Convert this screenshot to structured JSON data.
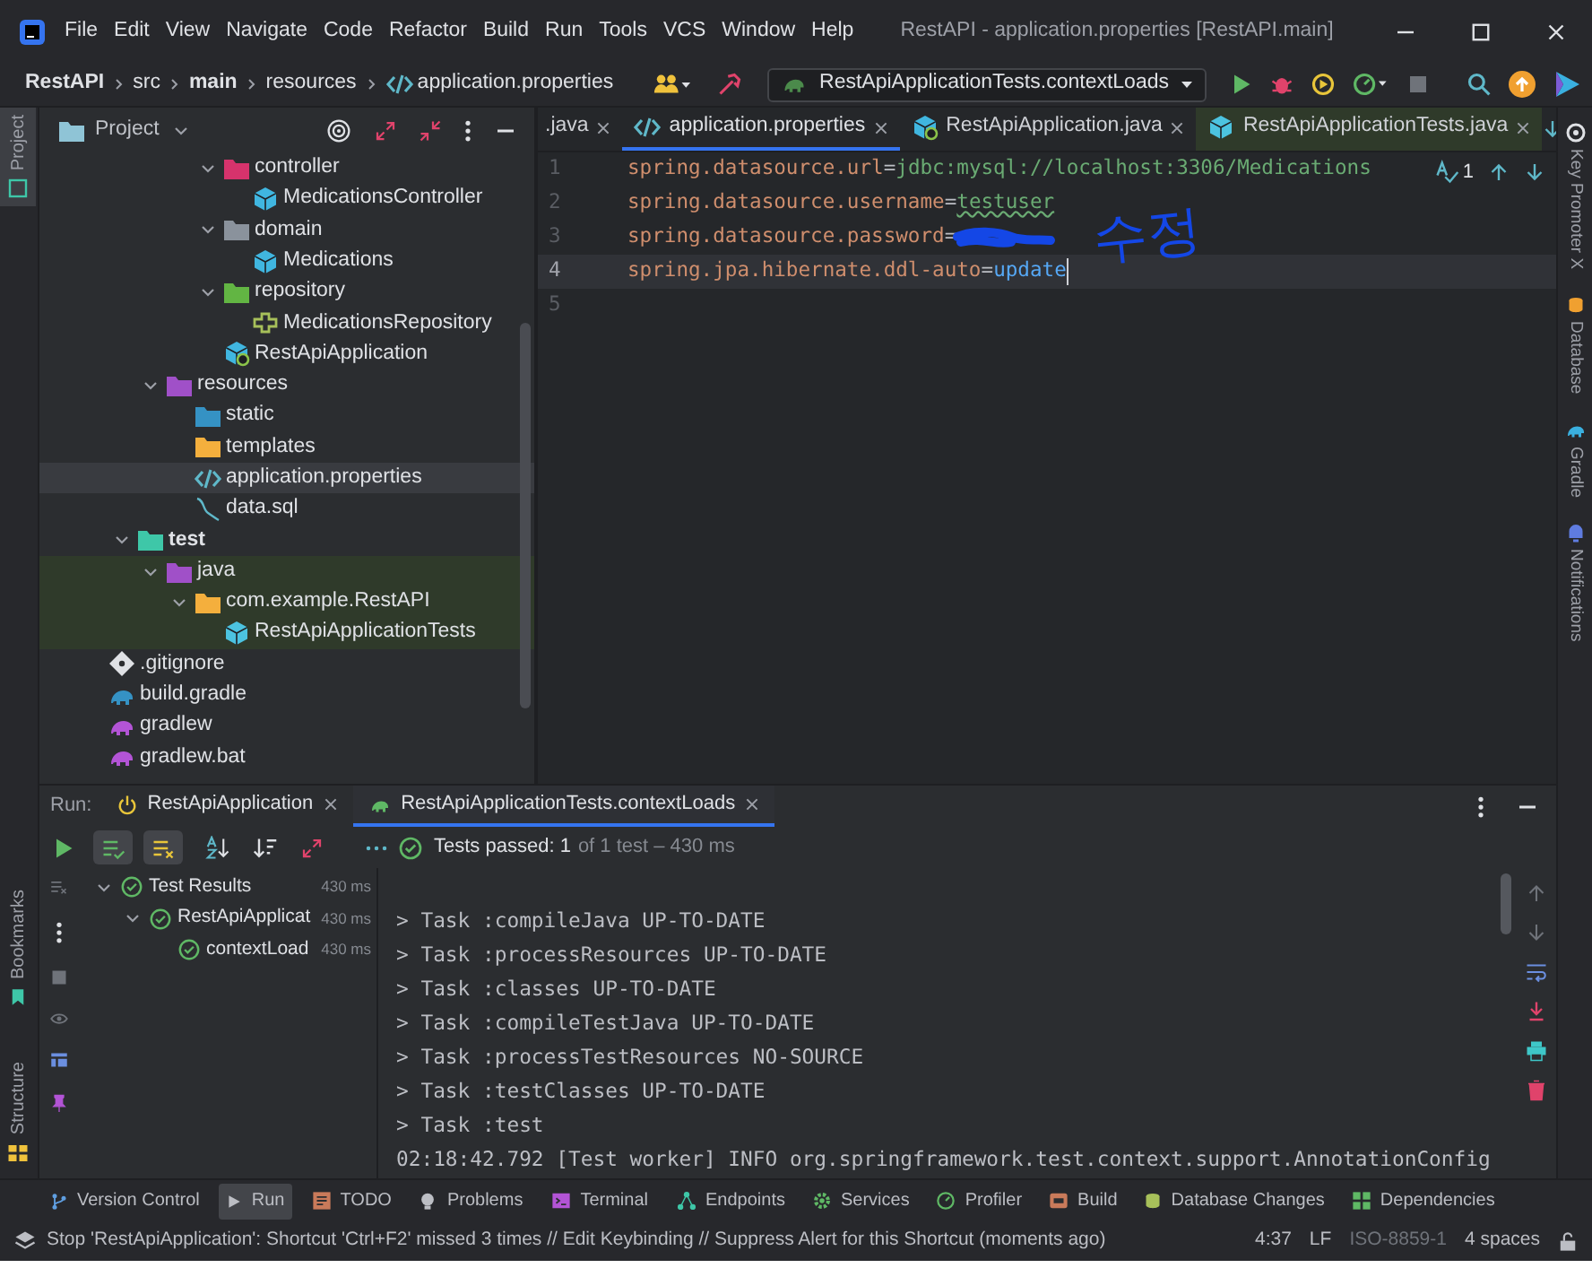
{
  "window": {
    "title": "RestAPI - application.properties [RestAPI.main]"
  },
  "menu": [
    "File",
    "Edit",
    "View",
    "Navigate",
    "Code",
    "Refactor",
    "Build",
    "Run",
    "Tools",
    "VCS",
    "Window",
    "Help"
  ],
  "breadcrumbs": [
    {
      "label": "RestAPI",
      "bold": true
    },
    {
      "label": "src",
      "bold": false
    },
    {
      "label": "main",
      "bold": true
    },
    {
      "label": "resources",
      "bold": false
    },
    {
      "label": "application.properties",
      "bold": false,
      "kind": "properties"
    }
  ],
  "run_configuration": {
    "label": "RestApiApplicationTests.contextLoads"
  },
  "left_tool_tabs": [
    {
      "label": "Project",
      "selected": true
    },
    {
      "label": "Bookmarks",
      "selected": false
    },
    {
      "label": "Structure",
      "selected": false
    }
  ],
  "right_tool_tabs": [
    {
      "label": "Key Promoter X"
    },
    {
      "label": "Database"
    },
    {
      "label": "Gradle"
    },
    {
      "label": "Notifications"
    }
  ],
  "project": {
    "title": "Project",
    "tree": [
      {
        "children": [
          {
            "children": [
              {
                "children": [
                  {
                    "children": [
                      {
                        "label": "controller",
                        "kind": "folder",
                        "color": "#d6336c",
                        "expanded": true,
                        "selected": false,
                        "test_scope": false,
                        "children": [
                          {
                            "label": "MedicationsController",
                            "kind": "class",
                            "selected": false,
                            "test_scope": false
                          }
                        ]
                      },
                      {
                        "label": "domain",
                        "kind": "folder",
                        "color": "#8a929c",
                        "expanded": true,
                        "selected": false,
                        "test_scope": false,
                        "children": [
                          {
                            "label": "Medications",
                            "kind": "class",
                            "selected": false,
                            "test_scope": false
                          }
                        ]
                      },
                      {
                        "label": "repository",
                        "kind": "folder",
                        "color": "#62b543",
                        "expanded": true,
                        "selected": false,
                        "test_scope": false,
                        "children": [
                          {
                            "label": "MedicationsRepository",
                            "kind": "interface",
                            "selected": false,
                            "test_scope": false
                          }
                        ]
                      },
                      {
                        "label": "RestApiApplication",
                        "kind": "app-class",
                        "selected": false,
                        "test_scope": false
                      }
                    ]
                  }
                ]
              },
              {
                "label": "resources",
                "kind": "folder",
                "color": "#a050c8",
                "expanded": true,
                "selected": false,
                "test_scope": false,
                "children": [
                  {
                    "label": "static",
                    "kind": "folder",
                    "color": "#3592c4",
                    "selected": false,
                    "test_scope": false
                  },
                  {
                    "label": "templates",
                    "kind": "folder",
                    "color": "#f4af3d",
                    "selected": false,
                    "test_scope": false
                  },
                  {
                    "label": "application.properties",
                    "kind": "properties",
                    "selected": true,
                    "test_scope": false
                  },
                  {
                    "label": "data.sql",
                    "kind": "sql",
                    "selected": false,
                    "test_scope": false
                  }
                ]
              }
            ]
          },
          {
            "label": "test",
            "kind": "source-root",
            "color": "#3ec7a8",
            "expanded": true,
            "selected": false,
            "test_scope": false,
            "children": [
              {
                "label": "java",
                "kind": "folder",
                "color": "#a050c8",
                "expanded": true,
                "selected": false,
                "test_scope": true,
                "children": [
                  {
                    "label": "com.example.RestAPI",
                    "kind": "folder",
                    "color": "#f4af3d",
                    "expanded": true,
                    "selected": false,
                    "test_scope": true,
                    "children": [
                      {
                        "label": "RestApiApplicationTests",
                        "kind": "test-class",
                        "selected": false,
                        "test_scope": true
                      }
                    ]
                  }
                ]
              }
            ]
          }
        ]
      },
      {
        "label": ".gitignore",
        "kind": "gitignore",
        "selected": false,
        "test_scope": false
      },
      {
        "label": "build.gradle",
        "kind": "gradle",
        "color": "#3592c4",
        "selected": false,
        "test_scope": false
      },
      {
        "label": "gradlew",
        "kind": "gradle",
        "color": "#b354d6",
        "selected": false,
        "test_scope": false
      },
      {
        "label": "gradlew.bat",
        "kind": "gradle",
        "color": "#b354d6",
        "selected": false,
        "test_scope": false
      }
    ]
  },
  "editor": {
    "tabs": [
      {
        "label": ".java",
        "selected": false,
        "test_scope": false
      },
      {
        "label": "application.properties",
        "kind": "properties",
        "selected": true,
        "test_scope": false
      },
      {
        "label": "RestApiApplication.java",
        "kind": "app-class",
        "selected": false,
        "test_scope": false
      },
      {
        "label": "RestApiApplicationTests.java",
        "kind": "test-class",
        "selected": false,
        "test_scope": true
      }
    ],
    "inspection_count": "1",
    "lines": [
      {
        "number": "1",
        "current": false,
        "segments": [
          {
            "text": "spring.datasource.url",
            "kind": "key"
          },
          {
            "text": "=",
            "kind": "sep"
          },
          {
            "text": "jdbc:mysql://localhost:3306/Medications",
            "kind": "string"
          }
        ]
      },
      {
        "number": "2",
        "current": false,
        "segments": [
          {
            "text": "spring.datasource.username",
            "kind": "key"
          },
          {
            "text": "=",
            "kind": "sep"
          },
          {
            "text": "testuser",
            "kind": "string",
            "typo": true
          }
        ]
      },
      {
        "number": "3",
        "current": false,
        "redacted": true,
        "segments": [
          {
            "text": "spring.datasource.password",
            "kind": "key"
          },
          {
            "text": "=",
            "kind": "sep"
          }
        ]
      },
      {
        "number": "4",
        "current": true,
        "caret": true,
        "segments": [
          {
            "text": "spring.jpa.hibernate.ddl-auto",
            "kind": "key"
          },
          {
            "text": "=",
            "kind": "sep"
          },
          {
            "text": "update",
            "kind": "keyword"
          }
        ]
      },
      {
        "number": "5",
        "current": false
      }
    ],
    "annotation": "수정"
  },
  "run": {
    "label": "Run:",
    "tabs": [
      {
        "label": "RestApiApplication",
        "selected": false
      },
      {
        "label": "RestApiApplicationTests.contextLoads",
        "selected": true
      }
    ],
    "toggles": [
      {
        "on": true
      },
      {
        "on": true
      }
    ],
    "summary": "Tests passed: 1",
    "summary_detail": "of 1 test – 430 ms",
    "test_tree": [
      {
        "label": "Test Results",
        "time": "430 ms",
        "passed": true,
        "expanded": true,
        "children": [
          {
            "label": "RestApiApplicat",
            "time": "430 ms",
            "passed": true,
            "expanded": true,
            "children": [
              {
                "label": "contextLoad",
                "time": "430 ms",
                "passed": true
              }
            ]
          }
        ]
      }
    ],
    "output": [
      "> Task :compileJava UP-TO-DATE",
      "> Task :processResources UP-TO-DATE",
      "> Task :classes UP-TO-DATE",
      "> Task :compileTestJava UP-TO-DATE",
      "> Task :processTestResources NO-SOURCE",
      "> Task :testClasses UP-TO-DATE",
      "> Task :test",
      "02:18:42.792 [Test worker] INFO org.springframework.test.context.support.AnnotationConfig"
    ]
  },
  "tool_windows": [
    {
      "label": "Version Control",
      "selected": false
    },
    {
      "label": "Run",
      "selected": true
    },
    {
      "label": "TODO",
      "selected": false
    },
    {
      "label": "Problems",
      "selected": false
    },
    {
      "label": "Terminal",
      "selected": false
    },
    {
      "label": "Endpoints",
      "selected": false
    },
    {
      "label": "Services",
      "selected": false
    },
    {
      "label": "Profiler",
      "selected": false
    },
    {
      "label": "Build",
      "selected": false
    },
    {
      "label": "Database Changes",
      "selected": false
    },
    {
      "label": "Dependencies",
      "selected": false
    }
  ],
  "status_bar": {
    "message": "Stop 'RestApiApplication': Shortcut 'Ctrl+F2' missed 3 times // Edit Keybinding // Suppress Alert for this Shortcut (moments ago)",
    "position": "4:37",
    "line_separator": "LF",
    "encoding": "ISO-8859-1",
    "indent": "4 spaces"
  }
}
